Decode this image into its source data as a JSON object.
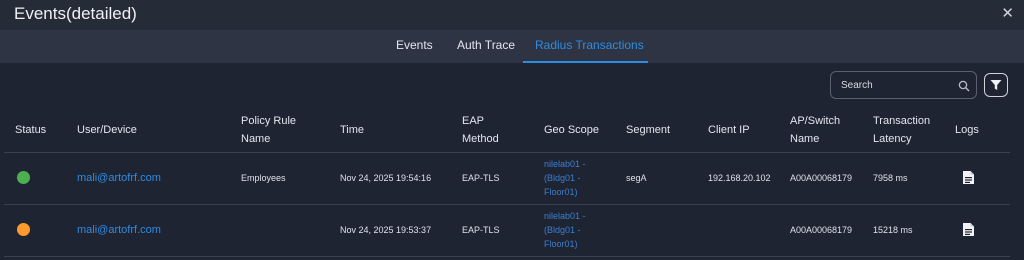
{
  "window": {
    "title": "Events(detailed)",
    "close_glyph": "✕"
  },
  "tabs": [
    {
      "label": "Events",
      "active": false
    },
    {
      "label": "Auth Trace",
      "active": false
    },
    {
      "label": "Radius Transactions",
      "active": true
    }
  ],
  "search": {
    "placeholder": "Search",
    "icon": "search-icon"
  },
  "filter": {
    "icon": "filter-icon"
  },
  "columns": {
    "status": "Status",
    "user": "User/Device",
    "policy_1": "Policy Rule",
    "policy_2": "Name",
    "time": "Time",
    "eap_1": "EAP",
    "eap_2": "Method",
    "geo": "Geo Scope",
    "segment": "Segment",
    "client_ip": "Client IP",
    "ap_1": "AP/Switch",
    "ap_2": "Name",
    "lat_1": "Transaction",
    "lat_2": "Latency",
    "logs": "Logs"
  },
  "rows": [
    {
      "status_color": "#4caf50",
      "user": "mali@artofrf.com",
      "policy": "Employees",
      "time": "Nov 24, 2025 19:54:16",
      "eap": "EAP-TLS",
      "geo": [
        "nilelab01 -",
        "(Bldg01 -",
        "Floor01)"
      ],
      "segment": "segA",
      "client_ip": "192.168.20.102",
      "ap": "A00A00068179",
      "latency": "7958 ms",
      "log_icon": "document-icon"
    },
    {
      "status_color": "#ff9a2e",
      "user": "mali@artofrf.com",
      "policy": "",
      "time": "Nov 24, 2025 19:53:37",
      "eap": "EAP-TLS",
      "geo": [
        "nilelab01 -",
        "(Bldg01 -",
        "Floor01)"
      ],
      "segment": "",
      "client_ip": "",
      "ap": "A00A00068179",
      "latency": "15218 ms",
      "log_icon": "document-icon"
    }
  ]
}
